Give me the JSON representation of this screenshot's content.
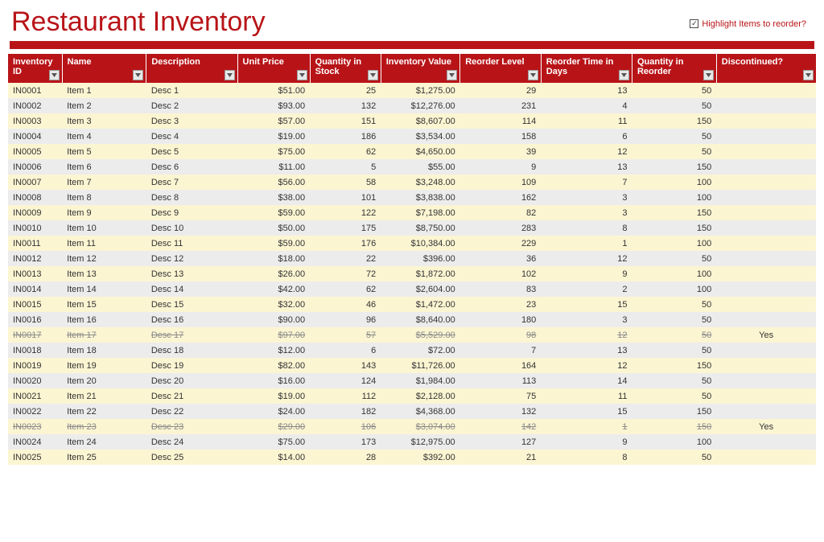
{
  "title": "Restaurant Inventory",
  "highlight": {
    "label": "Highlight Items to reorder?",
    "checked": true
  },
  "columns": [
    {
      "key": "id",
      "label": "Inventory ID",
      "align": "l"
    },
    {
      "key": "name",
      "label": "Name",
      "align": "l"
    },
    {
      "key": "desc",
      "label": "Description",
      "align": "l"
    },
    {
      "key": "up",
      "label": "Unit Price",
      "align": "r"
    },
    {
      "key": "qs",
      "label": "Quantity in Stock",
      "align": "r"
    },
    {
      "key": "iv",
      "label": "Inventory Value",
      "align": "r"
    },
    {
      "key": "rl",
      "label": "Reorder Level",
      "align": "r"
    },
    {
      "key": "rt",
      "label": "Reorder Time in Days",
      "align": "r"
    },
    {
      "key": "qr",
      "label": "Quantity in Reorder",
      "align": "r"
    },
    {
      "key": "dc",
      "label": "Discontinued?",
      "align": "c"
    }
  ],
  "rows": [
    {
      "id": "IN0001",
      "name": "Item 1",
      "desc": "Desc 1",
      "up": "$51.00",
      "qs": "25",
      "iv": "$1,275.00",
      "rl": "29",
      "rt": "13",
      "qr": "50",
      "dc": "",
      "disc": false
    },
    {
      "id": "IN0002",
      "name": "Item 2",
      "desc": "Desc 2",
      "up": "$93.00",
      "qs": "132",
      "iv": "$12,276.00",
      "rl": "231",
      "rt": "4",
      "qr": "50",
      "dc": "",
      "disc": false
    },
    {
      "id": "IN0003",
      "name": "Item 3",
      "desc": "Desc 3",
      "up": "$57.00",
      "qs": "151",
      "iv": "$8,607.00",
      "rl": "114",
      "rt": "11",
      "qr": "150",
      "dc": "",
      "disc": false
    },
    {
      "id": "IN0004",
      "name": "Item 4",
      "desc": "Desc 4",
      "up": "$19.00",
      "qs": "186",
      "iv": "$3,534.00",
      "rl": "158",
      "rt": "6",
      "qr": "50",
      "dc": "",
      "disc": false
    },
    {
      "id": "IN0005",
      "name": "Item 5",
      "desc": "Desc 5",
      "up": "$75.00",
      "qs": "62",
      "iv": "$4,650.00",
      "rl": "39",
      "rt": "12",
      "qr": "50",
      "dc": "",
      "disc": false
    },
    {
      "id": "IN0006",
      "name": "Item 6",
      "desc": "Desc 6",
      "up": "$11.00",
      "qs": "5",
      "iv": "$55.00",
      "rl": "9",
      "rt": "13",
      "qr": "150",
      "dc": "",
      "disc": false
    },
    {
      "id": "IN0007",
      "name": "Item 7",
      "desc": "Desc 7",
      "up": "$56.00",
      "qs": "58",
      "iv": "$3,248.00",
      "rl": "109",
      "rt": "7",
      "qr": "100",
      "dc": "",
      "disc": false
    },
    {
      "id": "IN0008",
      "name": "Item 8",
      "desc": "Desc 8",
      "up": "$38.00",
      "qs": "101",
      "iv": "$3,838.00",
      "rl": "162",
      "rt": "3",
      "qr": "100",
      "dc": "",
      "disc": false
    },
    {
      "id": "IN0009",
      "name": "Item 9",
      "desc": "Desc 9",
      "up": "$59.00",
      "qs": "122",
      "iv": "$7,198.00",
      "rl": "82",
      "rt": "3",
      "qr": "150",
      "dc": "",
      "disc": false
    },
    {
      "id": "IN0010",
      "name": "Item 10",
      "desc": "Desc 10",
      "up": "$50.00",
      "qs": "175",
      "iv": "$8,750.00",
      "rl": "283",
      "rt": "8",
      "qr": "150",
      "dc": "",
      "disc": false
    },
    {
      "id": "IN0011",
      "name": "Item 11",
      "desc": "Desc 11",
      "up": "$59.00",
      "qs": "176",
      "iv": "$10,384.00",
      "rl": "229",
      "rt": "1",
      "qr": "100",
      "dc": "",
      "disc": false
    },
    {
      "id": "IN0012",
      "name": "Item 12",
      "desc": "Desc 12",
      "up": "$18.00",
      "qs": "22",
      "iv": "$396.00",
      "rl": "36",
      "rt": "12",
      "qr": "50",
      "dc": "",
      "disc": false
    },
    {
      "id": "IN0013",
      "name": "Item 13",
      "desc": "Desc 13",
      "up": "$26.00",
      "qs": "72",
      "iv": "$1,872.00",
      "rl": "102",
      "rt": "9",
      "qr": "100",
      "dc": "",
      "disc": false
    },
    {
      "id": "IN0014",
      "name": "Item 14",
      "desc": "Desc 14",
      "up": "$42.00",
      "qs": "62",
      "iv": "$2,604.00",
      "rl": "83",
      "rt": "2",
      "qr": "100",
      "dc": "",
      "disc": false
    },
    {
      "id": "IN0015",
      "name": "Item 15",
      "desc": "Desc 15",
      "up": "$32.00",
      "qs": "46",
      "iv": "$1,472.00",
      "rl": "23",
      "rt": "15",
      "qr": "50",
      "dc": "",
      "disc": false
    },
    {
      "id": "IN0016",
      "name": "Item 16",
      "desc": "Desc 16",
      "up": "$90.00",
      "qs": "96",
      "iv": "$8,640.00",
      "rl": "180",
      "rt": "3",
      "qr": "50",
      "dc": "",
      "disc": false
    },
    {
      "id": "IN0017",
      "name": "Item 17",
      "desc": "Desc 17",
      "up": "$97.00",
      "qs": "57",
      "iv": "$5,529.00",
      "rl": "98",
      "rt": "12",
      "qr": "50",
      "dc": "Yes",
      "disc": true
    },
    {
      "id": "IN0018",
      "name": "Item 18",
      "desc": "Desc 18",
      "up": "$12.00",
      "qs": "6",
      "iv": "$72.00",
      "rl": "7",
      "rt": "13",
      "qr": "50",
      "dc": "",
      "disc": false
    },
    {
      "id": "IN0019",
      "name": "Item 19",
      "desc": "Desc 19",
      "up": "$82.00",
      "qs": "143",
      "iv": "$11,726.00",
      "rl": "164",
      "rt": "12",
      "qr": "150",
      "dc": "",
      "disc": false
    },
    {
      "id": "IN0020",
      "name": "Item 20",
      "desc": "Desc 20",
      "up": "$16.00",
      "qs": "124",
      "iv": "$1,984.00",
      "rl": "113",
      "rt": "14",
      "qr": "50",
      "dc": "",
      "disc": false
    },
    {
      "id": "IN0021",
      "name": "Item 21",
      "desc": "Desc 21",
      "up": "$19.00",
      "qs": "112",
      "iv": "$2,128.00",
      "rl": "75",
      "rt": "11",
      "qr": "50",
      "dc": "",
      "disc": false
    },
    {
      "id": "IN0022",
      "name": "Item 22",
      "desc": "Desc 22",
      "up": "$24.00",
      "qs": "182",
      "iv": "$4,368.00",
      "rl": "132",
      "rt": "15",
      "qr": "150",
      "dc": "",
      "disc": false
    },
    {
      "id": "IN0023",
      "name": "Item 23",
      "desc": "Desc 23",
      "up": "$29.00",
      "qs": "106",
      "iv": "$3,074.00",
      "rl": "142",
      "rt": "1",
      "qr": "150",
      "dc": "Yes",
      "disc": true
    },
    {
      "id": "IN0024",
      "name": "Item 24",
      "desc": "Desc 24",
      "up": "$75.00",
      "qs": "173",
      "iv": "$12,975.00",
      "rl": "127",
      "rt": "9",
      "qr": "100",
      "dc": "",
      "disc": false
    },
    {
      "id": "IN0025",
      "name": "Item 25",
      "desc": "Desc 25",
      "up": "$14.00",
      "qs": "28",
      "iv": "$392.00",
      "rl": "21",
      "rt": "8",
      "qr": "50",
      "dc": "",
      "disc": false
    }
  ]
}
